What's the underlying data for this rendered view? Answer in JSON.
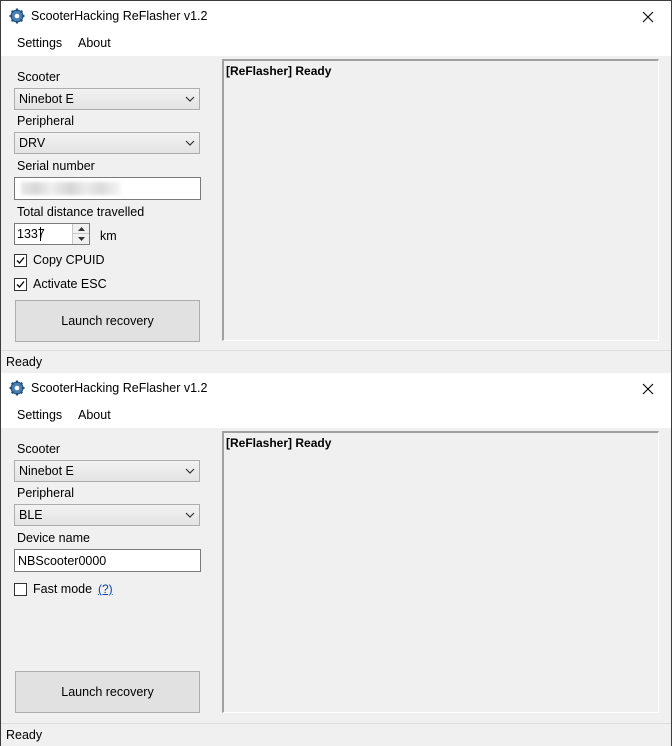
{
  "windows": [
    {
      "title": "ScooterHacking ReFlasher v1.2",
      "menu": [
        "Settings",
        "About"
      ],
      "scooter_label": "Scooter",
      "scooter_value": "Ninebot E",
      "peripheral_label": "Peripheral",
      "peripheral_value": "DRV",
      "serial_label": "Serial number",
      "serial_value": "",
      "distance_label": "Total distance travelled",
      "distance_value": "1337",
      "distance_unit": "km",
      "copy_cpuid_label": "Copy CPUID",
      "copy_cpuid_checked": true,
      "activate_esc_label": "Activate ESC",
      "activate_esc_checked": true,
      "launch_button": "Launch recovery",
      "log_text": "[ReFlasher] Ready",
      "status": "Ready"
    },
    {
      "title": "ScooterHacking ReFlasher v1.2",
      "menu": [
        "Settings",
        "About"
      ],
      "scooter_label": "Scooter",
      "scooter_value": "Ninebot E",
      "peripheral_label": "Peripheral",
      "peripheral_value": "BLE",
      "device_name_label": "Device name",
      "device_name_value": "NBScooter0000",
      "fast_mode_label": "Fast mode",
      "fast_mode_checked": false,
      "help_link": "(?)",
      "launch_button": "Launch recovery",
      "log_text": "[ReFlasher] Ready",
      "status": "Ready"
    }
  ],
  "icons": {
    "app": "gear-icon",
    "close": "close-icon",
    "dropdown": "chevron-down-icon",
    "check": "checkmark-icon"
  }
}
